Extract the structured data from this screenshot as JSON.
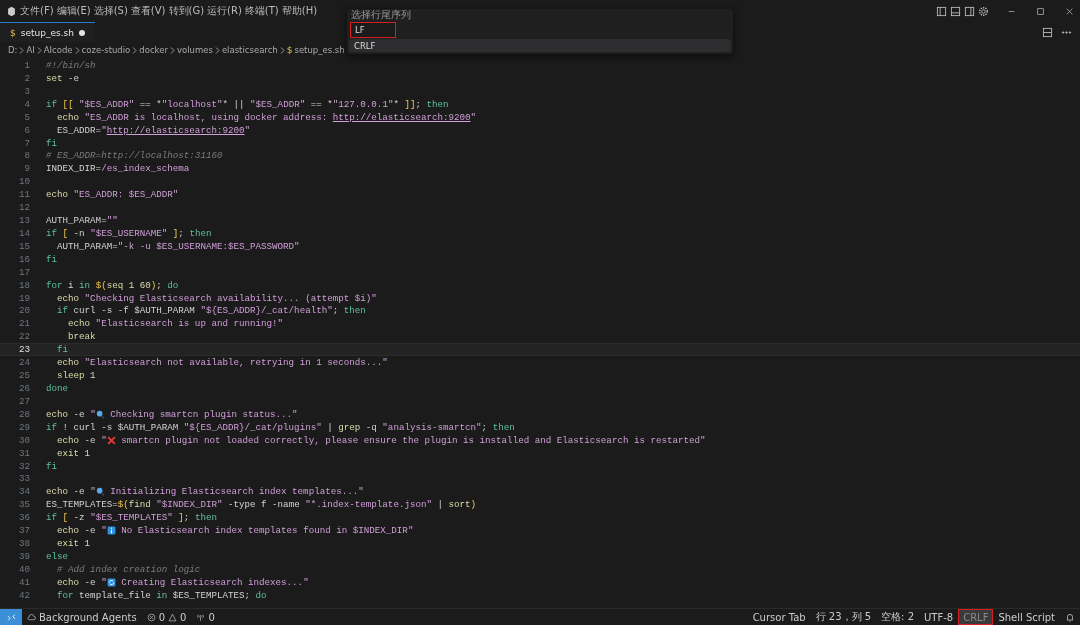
{
  "menu": [
    "文件(F)",
    "编辑(E)",
    "选择(S)",
    "查看(V)",
    "转到(G)",
    "运行(R)",
    "终端(T)",
    "帮助(H)"
  ],
  "quick_pick": {
    "title": "选择行尾序列",
    "value": "LF",
    "options": [
      {
        "label": "CRLF",
        "selected": true
      }
    ]
  },
  "tab": {
    "icon_text": "$",
    "label": "setup_es.sh",
    "modified": true
  },
  "breadcrumbs": [
    "D:",
    "AI",
    "AIcode",
    "coze-studio",
    "docker",
    "volumes",
    "elasticsearch",
    "setup_es.sh"
  ],
  "breadcrumb_file_icon": "$",
  "lines": [
    {
      "n": "1",
      "current": false,
      "tokens": [
        {
          "kind": "comment",
          "t": "#!/bin/sh"
        }
      ]
    },
    {
      "n": "2",
      "current": false,
      "tokens": [
        {
          "kind": "cmd",
          "t": "set"
        },
        {
          "kind": "plain",
          "t": " -e"
        }
      ]
    },
    {
      "n": "3",
      "current": false
    },
    {
      "n": "4",
      "current": false,
      "tokens": [
        {
          "kind": "kw",
          "t": "if"
        },
        {
          "kind": "paren",
          "t": " [[ "
        },
        {
          "kind": "str",
          "t": "\"$ES_ADDR\""
        },
        {
          "kind": "plain",
          "t": " == *"
        },
        {
          "kind": "str",
          "t": "\"localhost\""
        },
        {
          "kind": "plain",
          "t": "* || "
        },
        {
          "kind": "str",
          "t": "\"$ES_ADDR\""
        },
        {
          "kind": "plain",
          "t": " == *"
        },
        {
          "kind": "str",
          "t": "\"127.0.0.1\""
        },
        {
          "kind": "plain",
          "t": "* "
        },
        {
          "kind": "paren",
          "t": "]]"
        },
        {
          "kind": "plain",
          "t": "; "
        },
        {
          "kind": "kw",
          "t": "then"
        }
      ]
    },
    {
      "n": "5",
      "current": false,
      "tokens": [
        {
          "kind": "cmd",
          "t": "  echo"
        },
        {
          "kind": "str",
          "t": " \"ES_ADDR is localhost, using docker address: "
        },
        {
          "kind": "link",
          "t": "http://elasticsearch:9200"
        },
        {
          "kind": "str",
          "t": "\""
        }
      ]
    },
    {
      "n": "6",
      "current": false,
      "tokens": [
        {
          "kind": "plain",
          "t": "  ES_ADDR="
        },
        {
          "kind": "str",
          "t": "\""
        },
        {
          "kind": "link",
          "t": "http://elasticsearch:9200"
        },
        {
          "kind": "str",
          "t": "\""
        }
      ]
    },
    {
      "n": "7",
      "current": false,
      "tokens": [
        {
          "kind": "kw",
          "t": "fi"
        }
      ]
    },
    {
      "n": "8",
      "current": false,
      "tokens": [
        {
          "kind": "comment",
          "t": "# ES_ADDR=http://localhost:31160"
        }
      ]
    },
    {
      "n": "9",
      "current": false,
      "tokens": [
        {
          "kind": "plain",
          "t": "INDEX_DIR="
        },
        {
          "kind": "str",
          "t": "/es_index_schema"
        }
      ]
    },
    {
      "n": "10",
      "current": false
    },
    {
      "n": "11",
      "current": false,
      "tokens": [
        {
          "kind": "cmd",
          "t": "echo"
        },
        {
          "kind": "str",
          "t": " \"ES_ADDR: $ES_ADDR\""
        }
      ]
    },
    {
      "n": "12",
      "current": false
    },
    {
      "n": "13",
      "current": false,
      "tokens": [
        {
          "kind": "plain",
          "t": "AUTH_PARAM="
        },
        {
          "kind": "str",
          "t": "\"\""
        }
      ]
    },
    {
      "n": "14",
      "current": false,
      "tokens": [
        {
          "kind": "kw",
          "t": "if"
        },
        {
          "kind": "paren",
          "t": " [ "
        },
        {
          "kind": "plain",
          "t": "-n "
        },
        {
          "kind": "str",
          "t": "\"$ES_USERNAME\""
        },
        {
          "kind": "paren",
          "t": " ]"
        },
        {
          "kind": "plain",
          "t": "; "
        },
        {
          "kind": "kw",
          "t": "then"
        }
      ]
    },
    {
      "n": "15",
      "current": false,
      "tokens": [
        {
          "kind": "plain",
          "t": "  AUTH_PARAM="
        },
        {
          "kind": "str",
          "t": "\"-k -u $ES_USERNAME:$ES_PASSWORD\""
        }
      ]
    },
    {
      "n": "16",
      "current": false,
      "tokens": [
        {
          "kind": "kw",
          "t": "fi"
        }
      ]
    },
    {
      "n": "17",
      "current": false
    },
    {
      "n": "18",
      "current": false,
      "tokens": [
        {
          "kind": "kw",
          "t": "for"
        },
        {
          "kind": "plain",
          "t": " i "
        },
        {
          "kind": "kw",
          "t": "in"
        },
        {
          "kind": "paren",
          "t": " $("
        },
        {
          "kind": "cmd",
          "t": "seq 1 60"
        },
        {
          "kind": "paren",
          "t": ")"
        },
        {
          "kind": "plain",
          "t": "; "
        },
        {
          "kind": "kw",
          "t": "do"
        }
      ]
    },
    {
      "n": "19",
      "current": false,
      "tokens": [
        {
          "kind": "cmd",
          "t": "  echo"
        },
        {
          "kind": "str",
          "t": " \"Checking Elasticsearch availability... (attempt $i)\""
        }
      ]
    },
    {
      "n": "20",
      "current": false,
      "tokens": [
        {
          "kind": "kw",
          "t": "  if"
        },
        {
          "kind": "plain",
          "t": " curl -s -f $AUTH_PARAM "
        },
        {
          "kind": "str",
          "t": "\"${ES_ADDR}/_cat/health\""
        },
        {
          "kind": "plain",
          "t": "; "
        },
        {
          "kind": "kw",
          "t": "then"
        }
      ]
    },
    {
      "n": "21",
      "current": false,
      "tokens": [
        {
          "kind": "cmd",
          "t": "    echo"
        },
        {
          "kind": "str",
          "t": " \"Elasticsearch is up and running!\""
        }
      ]
    },
    {
      "n": "22",
      "current": false,
      "tokens": [
        {
          "kind": "cmd",
          "t": "    break"
        }
      ]
    },
    {
      "n": "23",
      "current": true,
      "tokens": [
        {
          "kind": "kw",
          "t": "  fi"
        }
      ]
    },
    {
      "n": "24",
      "current": false,
      "tokens": [
        {
          "kind": "cmd",
          "t": "  echo"
        },
        {
          "kind": "str",
          "t": " \"Elasticsearch not available, retrying in 1 seconds...\""
        }
      ]
    },
    {
      "n": "25",
      "current": false,
      "tokens": [
        {
          "kind": "cmd",
          "t": "  sleep"
        },
        {
          "kind": "plain",
          "t": " 1"
        }
      ]
    },
    {
      "n": "26",
      "current": false,
      "tokens": [
        {
          "kind": "kw",
          "t": "done"
        }
      ]
    },
    {
      "n": "27",
      "current": false
    },
    {
      "n": "28",
      "current": false,
      "tokens": [
        {
          "kind": "cmd",
          "t": "echo"
        },
        {
          "kind": "plain",
          "t": " -e "
        },
        {
          "kind": "str",
          "t": "\""
        },
        {
          "kind": "lens"
        },
        {
          "kind": "str",
          "t": " Checking smartcn plugin status...\""
        }
      ]
    },
    {
      "n": "29",
      "current": false,
      "tokens": [
        {
          "kind": "kw",
          "t": "if"
        },
        {
          "kind": "plain",
          "t": " ! curl -s $AUTH_PARAM "
        },
        {
          "kind": "str",
          "t": "\"${ES_ADDR}/_cat/plugins\""
        },
        {
          "kind": "plain",
          "t": " | "
        },
        {
          "kind": "cmd",
          "t": "grep"
        },
        {
          "kind": "plain",
          "t": " -q "
        },
        {
          "kind": "str",
          "t": "\"analysis-smartcn\""
        },
        {
          "kind": "plain",
          "t": "; "
        },
        {
          "kind": "kw",
          "t": "then"
        }
      ]
    },
    {
      "n": "30",
      "current": false,
      "tokens": [
        {
          "kind": "cmd",
          "t": "  echo"
        },
        {
          "kind": "plain",
          "t": " -e "
        },
        {
          "kind": "str",
          "t": "\""
        },
        {
          "kind": "cross"
        },
        {
          "kind": "str",
          "t": " smartcn plugin not loaded correctly, please ensure the plugin is installed and Elasticsearch is restarted\""
        }
      ]
    },
    {
      "n": "31",
      "current": false,
      "tokens": [
        {
          "kind": "cmd",
          "t": "  exit"
        },
        {
          "kind": "plain",
          "t": " 1"
        }
      ]
    },
    {
      "n": "32",
      "current": false,
      "tokens": [
        {
          "kind": "kw",
          "t": "fi"
        }
      ]
    },
    {
      "n": "33",
      "current": false
    },
    {
      "n": "34",
      "current": false,
      "tokens": [
        {
          "kind": "cmd",
          "t": "echo"
        },
        {
          "kind": "plain",
          "t": " -e "
        },
        {
          "kind": "str",
          "t": "\""
        },
        {
          "kind": "lens"
        },
        {
          "kind": "str",
          "t": " Initializing Elasticsearch index templates...\""
        }
      ]
    },
    {
      "n": "35",
      "current": false,
      "tokens": [
        {
          "kind": "plain",
          "t": "ES_TEMPLATES="
        },
        {
          "kind": "paren",
          "t": "$("
        },
        {
          "kind": "cmd",
          "t": "find"
        },
        {
          "kind": "str",
          "t": " \"$INDEX_DIR\""
        },
        {
          "kind": "plain",
          "t": " -type f -name "
        },
        {
          "kind": "str",
          "t": "\"*.index-template.json\""
        },
        {
          "kind": "plain",
          "t": " | "
        },
        {
          "kind": "cmd",
          "t": "sort"
        },
        {
          "kind": "paren",
          "t": ")"
        }
      ]
    },
    {
      "n": "36",
      "current": false,
      "tokens": [
        {
          "kind": "kw",
          "t": "if"
        },
        {
          "kind": "paren",
          "t": " [ "
        },
        {
          "kind": "plain",
          "t": "-z "
        },
        {
          "kind": "str",
          "t": "\"$ES_TEMPLATES\""
        },
        {
          "kind": "paren",
          "t": " ]"
        },
        {
          "kind": "plain",
          "t": "; "
        },
        {
          "kind": "kw",
          "t": "then"
        }
      ]
    },
    {
      "n": "37",
      "current": false,
      "tokens": [
        {
          "kind": "cmd",
          "t": "  echo"
        },
        {
          "kind": "plain",
          "t": " -e "
        },
        {
          "kind": "str",
          "t": "\""
        },
        {
          "kind": "info"
        },
        {
          "kind": "str",
          "t": " No Elasticsearch index templates found in $INDEX_DIR\""
        }
      ]
    },
    {
      "n": "38",
      "current": false,
      "tokens": [
        {
          "kind": "cmd",
          "t": "  exit"
        },
        {
          "kind": "plain",
          "t": " 1"
        }
      ]
    },
    {
      "n": "39",
      "current": false,
      "tokens": [
        {
          "kind": "kw",
          "t": "else"
        }
      ]
    },
    {
      "n": "40",
      "current": false,
      "tokens": [
        {
          "kind": "comment",
          "t": "  # Add index creation logic"
        }
      ]
    },
    {
      "n": "41",
      "current": false,
      "tokens": [
        {
          "kind": "cmd",
          "t": "  echo"
        },
        {
          "kind": "plain",
          "t": " -e "
        },
        {
          "kind": "str",
          "t": "\""
        },
        {
          "kind": "cycle"
        },
        {
          "kind": "str",
          "t": " Creating Elasticsearch indexes...\""
        }
      ]
    },
    {
      "n": "42",
      "current": false,
      "tokens": [
        {
          "kind": "kw",
          "t": "  for"
        },
        {
          "kind": "plain",
          "t": " template_file "
        },
        {
          "kind": "kw",
          "t": "in"
        },
        {
          "kind": "plain",
          "t": " $ES_TEMPLATES; "
        },
        {
          "kind": "kw",
          "t": "do"
        }
      ]
    }
  ],
  "status_left": {
    "agents": "Background Agents",
    "errors": "0",
    "warnings": "0",
    "ports": "0"
  },
  "status_right": [
    {
      "label": "Cursor Tab",
      "highlighted": false
    },
    {
      "label": "行 23，列 5",
      "highlighted": false
    },
    {
      "label": "空格: 2",
      "highlighted": false
    },
    {
      "label": "UTF-8",
      "highlighted": false
    },
    {
      "label": "CRLF",
      "highlighted": true
    },
    {
      "label": "Shell Script",
      "highlighted": false
    }
  ]
}
